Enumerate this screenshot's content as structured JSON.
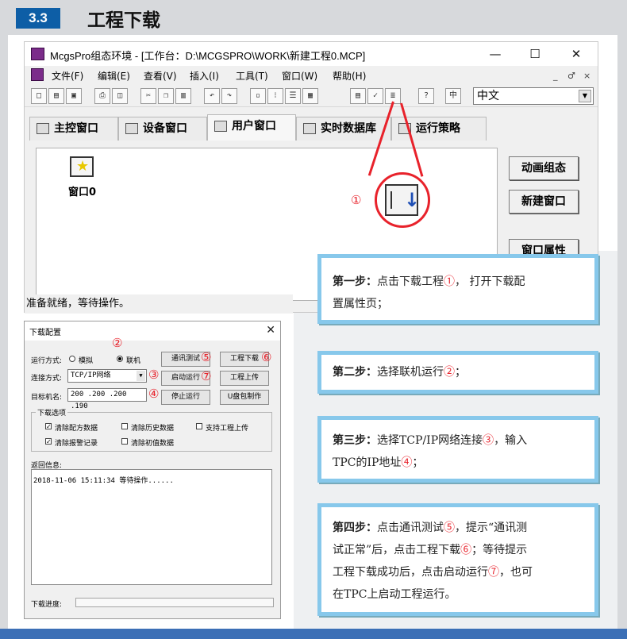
{
  "header": {
    "number": "3.3",
    "title": "工程下载"
  },
  "window": {
    "title": "McgsPro组态环境 - [工作台：D:\\MCGSPRO\\WORK\\新建工程0.MCP]",
    "controls": {
      "minimize": "—",
      "maximize": "☐",
      "close": "✕"
    },
    "menu": [
      "文件(F)",
      "编辑(E)",
      "查看(V)",
      "插入(I)",
      "工具(T)",
      "窗口(W)",
      "帮助(H)"
    ],
    "mdi_controls": [
      "_",
      "♂",
      "×"
    ],
    "language": "中文",
    "tabs": [
      "主控窗口",
      "设备窗口",
      "用户窗口",
      "实时数据库",
      "运行策略"
    ],
    "active_tab": "用户窗口",
    "window_item_label": "窗口0",
    "side_buttons": [
      "动画组态",
      "新建窗口",
      "窗口属性"
    ],
    "status": "准备就绪，等待操作。",
    "callout_number": "①"
  },
  "dialog": {
    "title": "下载配置",
    "close": "✕",
    "run_mode_label": "运行方式:",
    "run_mode_options": [
      "模拟",
      "联机"
    ],
    "run_mode_selected": "联机",
    "connection_label": "连接方式:",
    "connection_value": "TCP/IP网络",
    "target_label": "目标机名:",
    "target_value": "200 .200 .200 .190",
    "buttons": {
      "comm_test": "通讯测试",
      "download": "工程下载",
      "start_run": "启动运行",
      "upload": "工程上传",
      "stop_run": "停止运行",
      "usb_make": "U盘包制作"
    },
    "options_group": "下载选项",
    "options": [
      {
        "label": "清除配方数据",
        "checked": true
      },
      {
        "label": "清除历史数据",
        "checked": false
      },
      {
        "label": "支持工程上传",
        "checked": false
      },
      {
        "label": "清除报警记录",
        "checked": true
      },
      {
        "label": "清除初值数据",
        "checked": false
      }
    ],
    "log_label": "返回信息:",
    "log_entry": "2018-11-06 15:11:34    等待操作......",
    "progress_label": "下载进度:",
    "markers": [
      "②",
      "③",
      "④",
      "⑤",
      "⑥",
      "⑦"
    ]
  },
  "steps": [
    {
      "title": "第一步：",
      "body1": "点击下载工程",
      "num1": "①",
      "body2": "， 打开下载配",
      "line2": "置属性页；"
    },
    {
      "title": "第二步：",
      "body1": "选择联机运行",
      "num1": "②",
      "body2": "；"
    },
    {
      "title": "第三步：",
      "body1": "选择TCP/IP网络连接",
      "num1": "③",
      "body2": "，输入",
      "line2a": "TPC的IP地址",
      "num2": "④",
      "line2b": "；"
    },
    {
      "title": "第四步：",
      "line1a": "点击通讯测试",
      "num1": "⑤",
      "line1b": "，提示“通讯测",
      "line2a": "试正常”后，点击工程下载",
      "num2": "⑥",
      "line2b": "；等待提示",
      "line3a": "工程下载成功后，点击启动运行",
      "num3": "⑦",
      "line3b": "，也可",
      "line4": "在TPC上启动工程运行。"
    }
  ]
}
